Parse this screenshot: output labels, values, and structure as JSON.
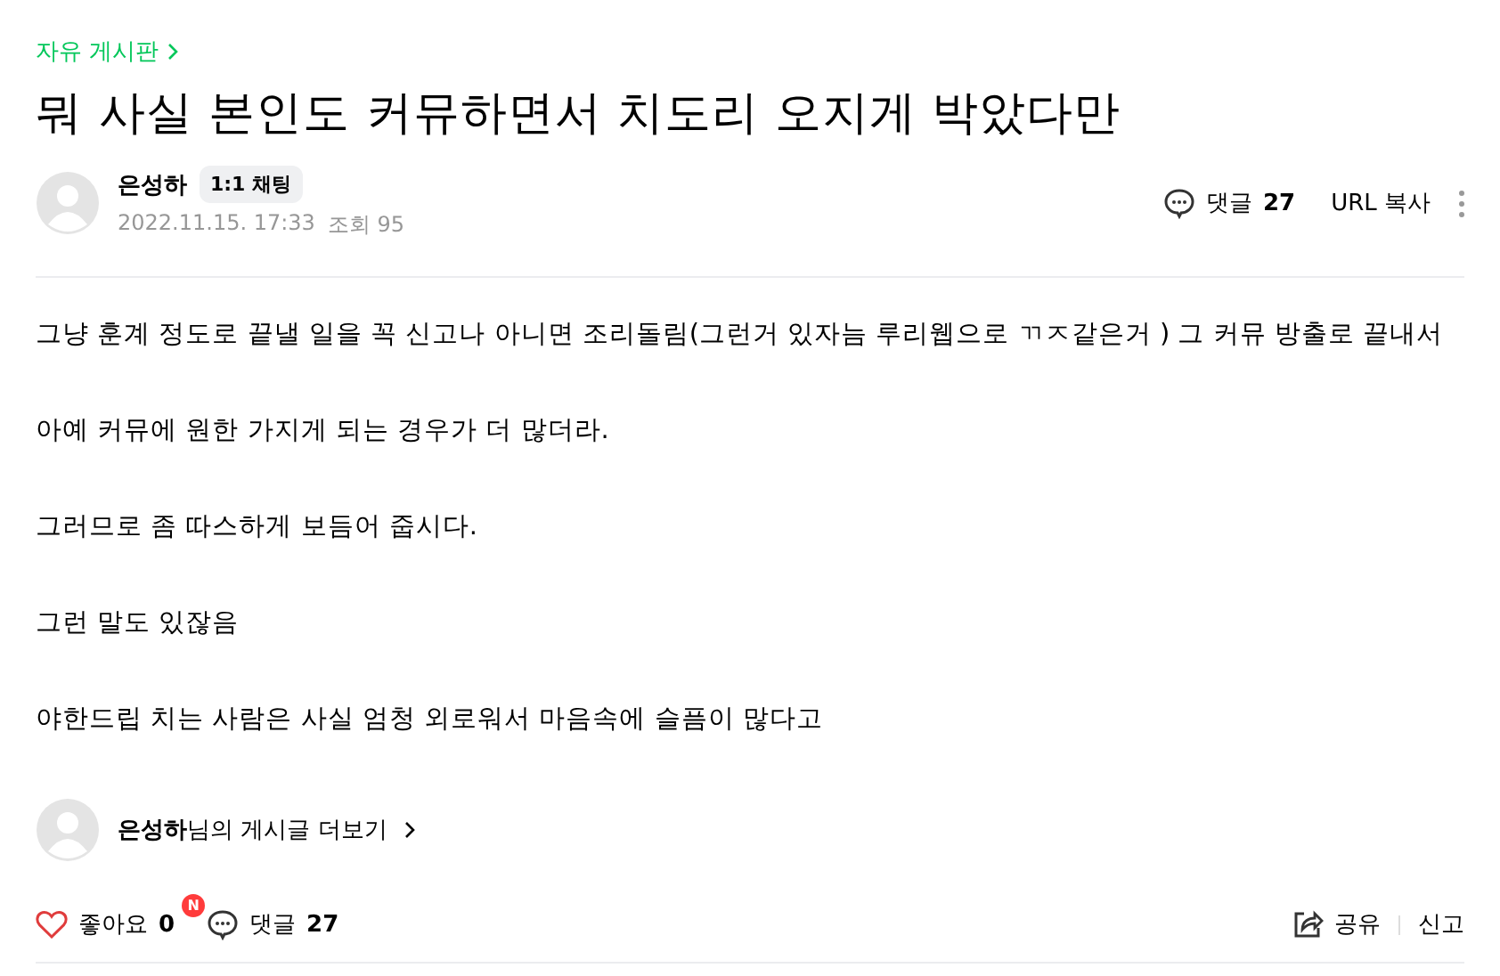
{
  "board": {
    "label": "자유 게시판"
  },
  "title": "뭐 사실 본인도 커뮤하면서 치도리 오지게 박았다만",
  "author": {
    "name": "은성하",
    "chat_button": "1:1 채팅",
    "date": "2022.11.15. 17:33",
    "views": "조회 95"
  },
  "header_actions": {
    "comments_label": "댓글",
    "comments_count": "27",
    "url_copy": "URL 복사"
  },
  "paragraphs": [
    "그냥 훈계 정도로 끝낼 일을 꼭 신고나 아니면 조리돌림(그런거 있자늠 루리웹으로 ㄲㅈ같은거 ) 그 커뮤 방출로 끝내서",
    "아예 커뮤에 원한 가지게 되는 경우가 더 많더라.",
    "그러므로 좀 따스하게 보듬어 줍시다.",
    "그런 말도 있잖음",
    "야한드립 치는 사람은 사실 엄청 외로워서 마음속에 슬픔이 많다고"
  ],
  "more_posts": "**은성하**님의 게시글 더보기",
  "bottom": {
    "like_label": "좋아요",
    "like_count": "0",
    "comment_badge": "N",
    "comment_label": "댓글",
    "comment_count": "27",
    "share": "공유",
    "report": "신고"
  }
}
